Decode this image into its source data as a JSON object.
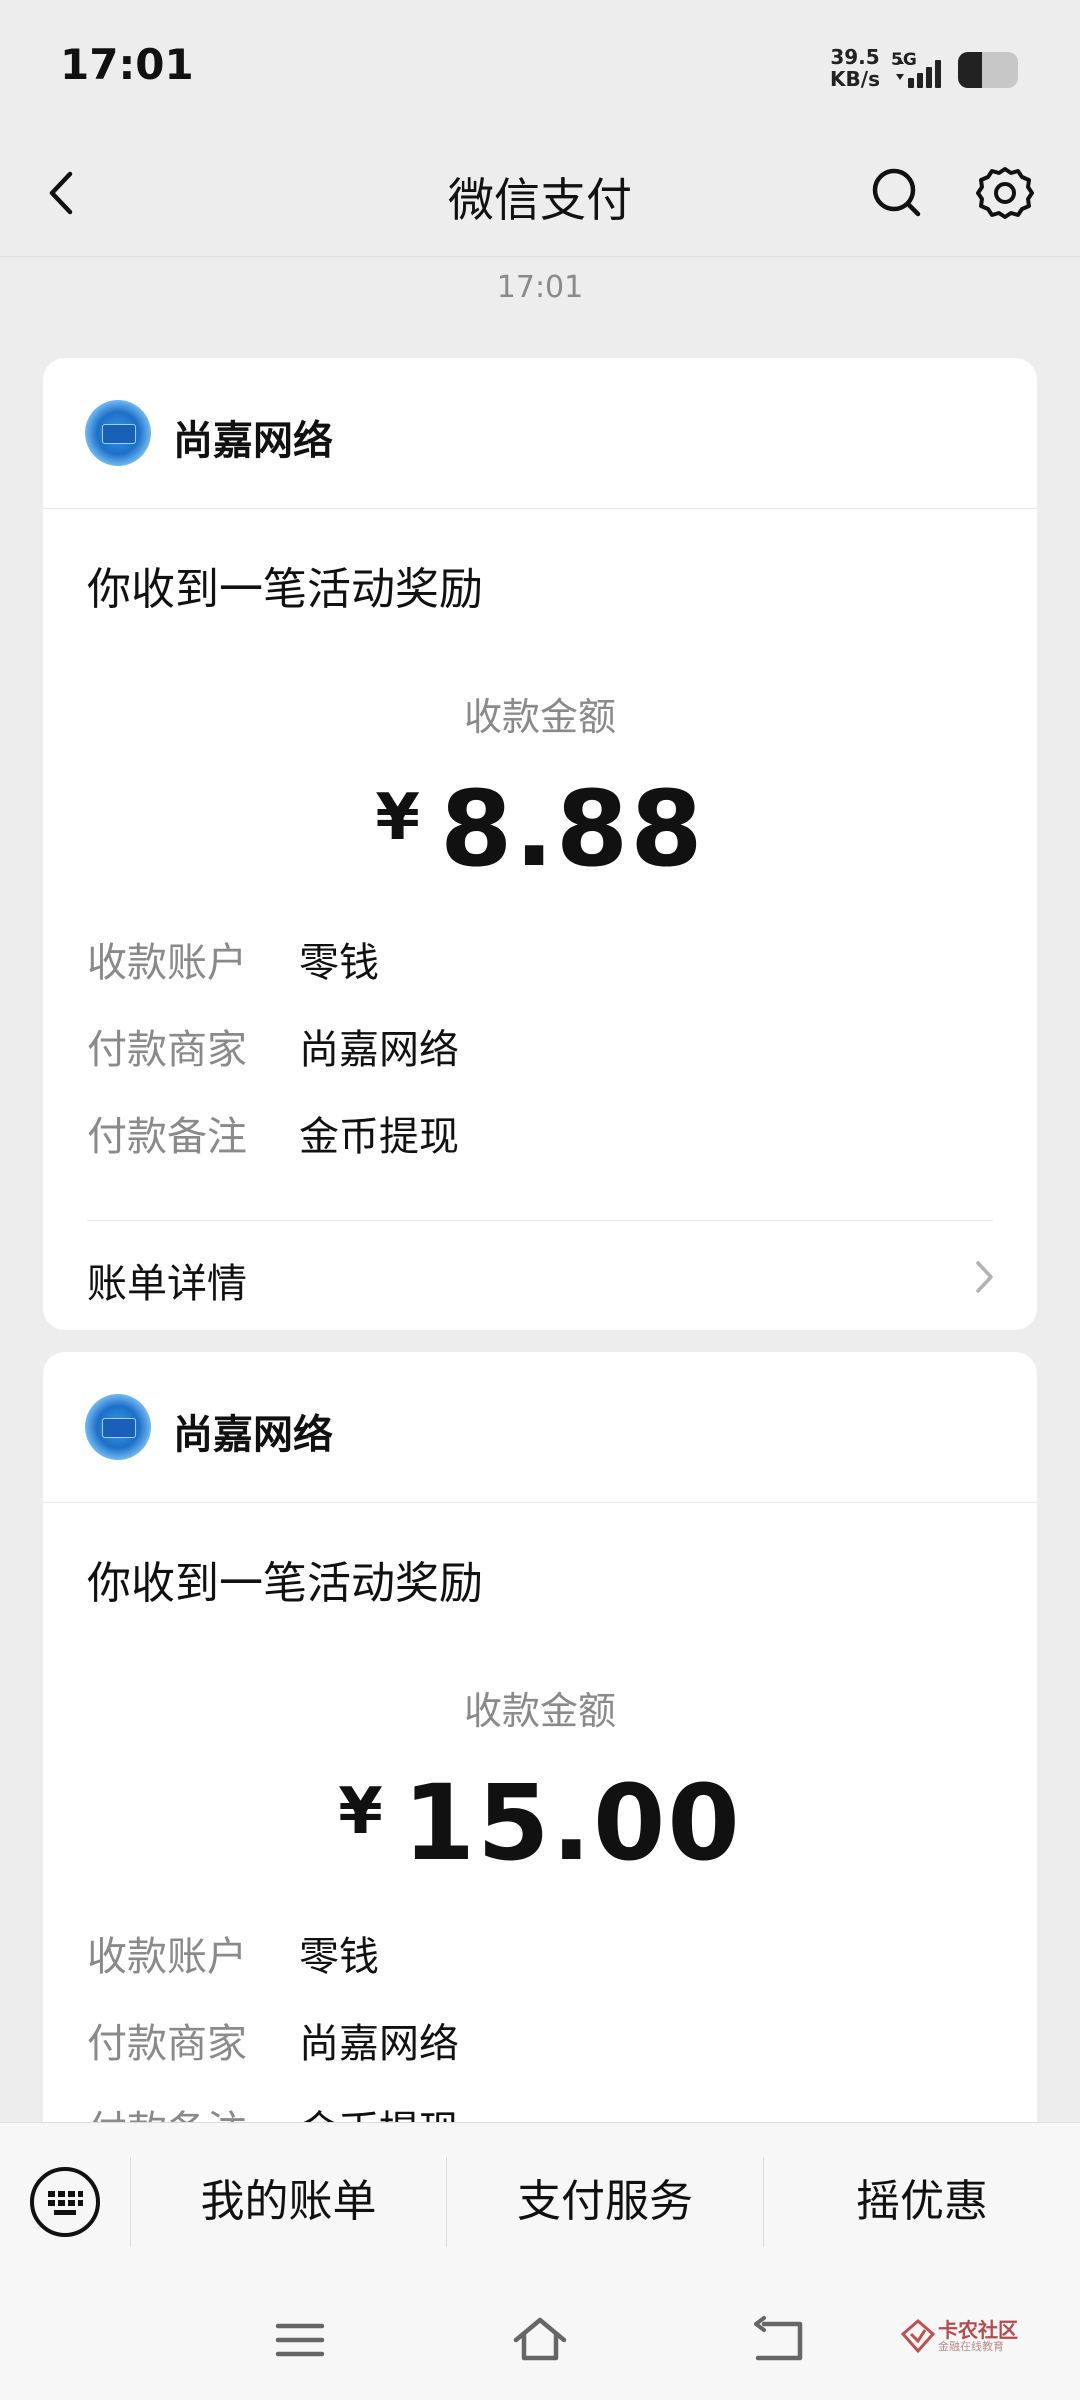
{
  "status_bar": {
    "time": "17:01",
    "net_speed_value": "39.5",
    "net_speed_unit": "KB/s",
    "network_type": "5G",
    "signal_icon": "signal-bars-icon",
    "battery_icon": "battery-icon"
  },
  "nav": {
    "title": "微信支付",
    "back_icon": "back-arrow-icon",
    "search_icon": "search-icon",
    "settings_icon": "gear-icon"
  },
  "message_time": "17:01",
  "cards": [
    {
      "merchant": "尚嘉网络",
      "title": "你收到一笔活动奖励",
      "amount_label": "收款金额",
      "currency": "¥",
      "amount": "8.88",
      "details": [
        {
          "key": "收款账户",
          "value": "零钱"
        },
        {
          "key": "付款商家",
          "value": "尚嘉网络"
        },
        {
          "key": "付款备注",
          "value": "金币提现"
        }
      ],
      "bill_detail": "账单详情"
    },
    {
      "merchant": "尚嘉网络",
      "title": "你收到一笔活动奖励",
      "amount_label": "收款金额",
      "currency": "¥",
      "amount": "15.00",
      "details": [
        {
          "key": "收款账户",
          "value": "零钱"
        },
        {
          "key": "付款商家",
          "value": "尚嘉网络"
        },
        {
          "key": "付款备注",
          "value": "金币提现"
        }
      ]
    }
  ],
  "bottom_menu": {
    "keyboard_icon": "keyboard-icon",
    "items": [
      "我的账单",
      "支付服务",
      "摇优惠"
    ]
  },
  "system_nav": {
    "menu_icon": "menu-icon",
    "home_icon": "home-icon",
    "back_icon": "return-icon"
  },
  "watermark": {
    "title": "卡农社区",
    "subtitle": "金融在线教育"
  },
  "colors": {
    "background": "#ededed",
    "card": "#ffffff",
    "primary_text": "#111111",
    "secondary_text": "#8a8a8a"
  }
}
